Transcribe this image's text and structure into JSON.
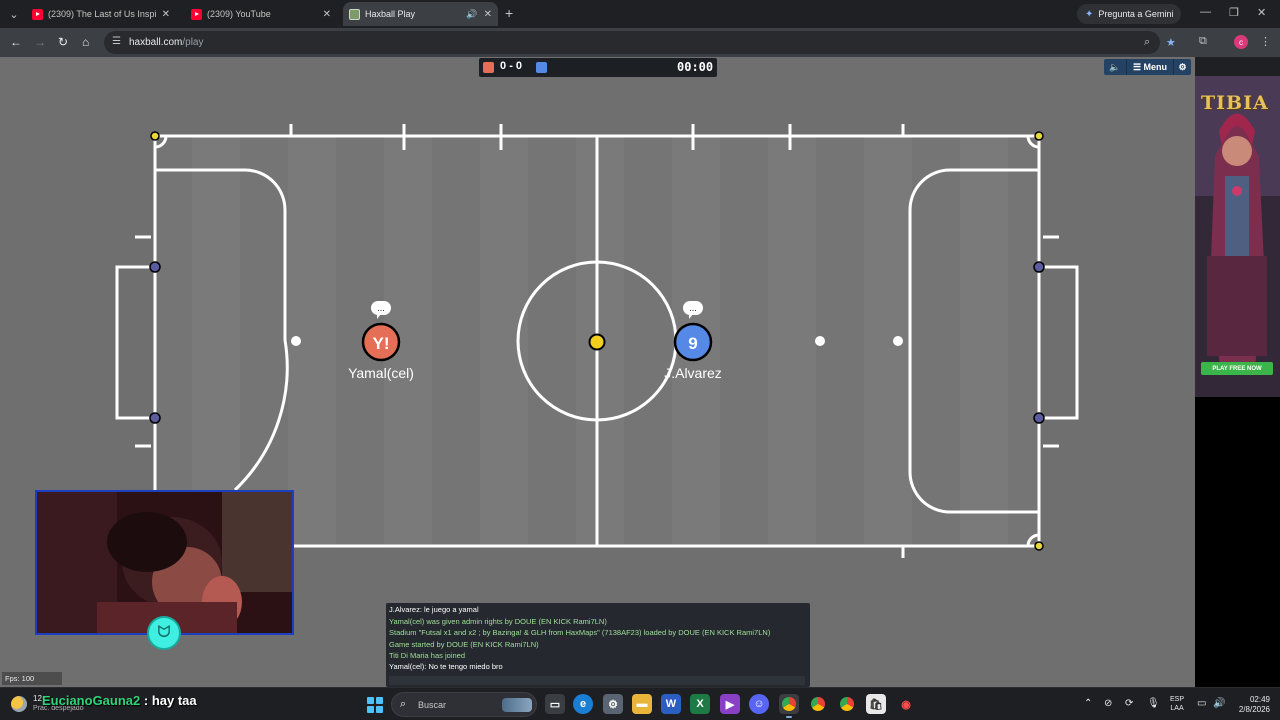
{
  "browser": {
    "tabs": [
      {
        "title": "(2309) The Last of Us Inspired A",
        "favicon": "youtube-icon"
      },
      {
        "title": "(2309) YouTube",
        "favicon": "youtube-icon"
      },
      {
        "title": "Haxball Play",
        "favicon": "haxball-icon",
        "active": true
      }
    ],
    "gemini_label": "Pregunta a Gemini",
    "url_host": "haxball.com",
    "url_path": "/play",
    "profile_initial": "c"
  },
  "game": {
    "score_red": "0",
    "score_blue": "0",
    "score_sep": "-",
    "clock": "00:00",
    "menu_label": "Menu",
    "red_color": "#e56e56",
    "blue_color": "#5689e5",
    "players": [
      {
        "name": "Yamal(cel)",
        "avatar": "Y!",
        "team": "red",
        "chat": "..."
      },
      {
        "name": "J.Alvarez",
        "avatar": "9",
        "team": "blue",
        "chat": "..."
      }
    ],
    "fps_label": "Fps: 100"
  },
  "chat": {
    "lines": [
      {
        "text": "J.Alvarez: le juego a yamal",
        "type": "msg"
      },
      {
        "text": "Yamal(cel) was given admin rights by DOUE (EN KICK Rami7LN)",
        "type": "sys"
      },
      {
        "text": "Stadium \"Futsal x1 and x2 ; by Bazinga! & GLH from HaxMaps\" (7138AF23) loaded by DOUE (EN KICK Rami7LN)",
        "type": "sys"
      },
      {
        "text": "Game started by DOUE (EN KICK Rami7LN)",
        "type": "sys"
      },
      {
        "text": "Titi Di Maria has joined",
        "type": "sys"
      },
      {
        "text": "Yamal(cel): No te tengo miedo bro",
        "type": "msg"
      }
    ]
  },
  "ad": {
    "title": "TIBIA",
    "button": "PLAY FREE NOW"
  },
  "stream_overlay": {
    "user": "EucianoGauna2",
    "message": ": hay taa"
  },
  "taskbar": {
    "weather_temp": "12",
    "weather_desc": "Prac. despejado",
    "search_placeholder": "Buscar",
    "lang_line1": "ESP",
    "lang_line2": "LAA",
    "time": "02:49",
    "date": "2/8/2026"
  }
}
